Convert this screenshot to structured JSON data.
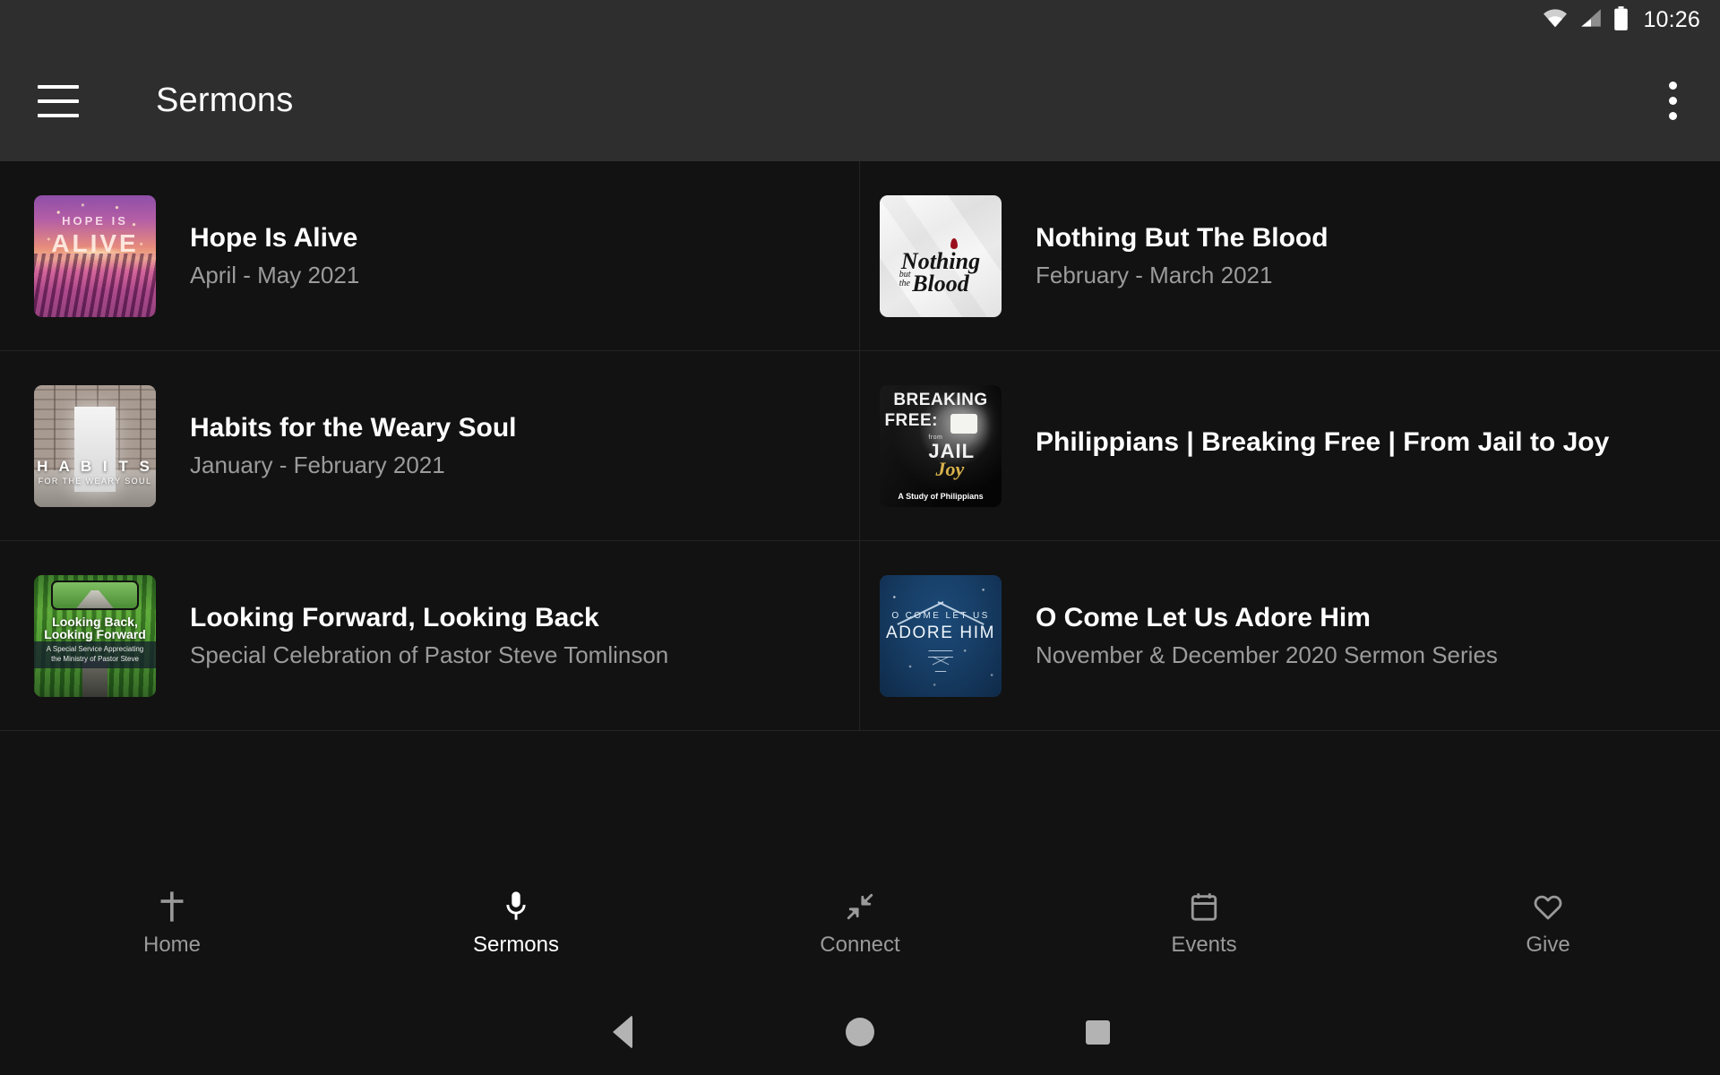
{
  "status_bar": {
    "time": "10:26",
    "icons": [
      "wifi-icon",
      "cellular-signal-icon",
      "battery-icon"
    ]
  },
  "app_bar": {
    "menu_icon": "hamburger-menu-icon",
    "title": "Sermons",
    "overflow_icon": "more-vertical-icon"
  },
  "sermons": [
    {
      "title": "Hope Is Alive",
      "subtitle": "April - May 2021",
      "thumb": {
        "style": "art-hope",
        "line1": "HOPE IS",
        "line2": "ALIVE"
      }
    },
    {
      "title": "Nothing But The Blood",
      "subtitle": "February - March 2021",
      "thumb": {
        "style": "art-blood",
        "word1": "Nothing",
        "word2": "Blood",
        "small1": "but",
        "small2": "the"
      }
    },
    {
      "title": "Habits for the Weary Soul",
      "subtitle": "January - February 2021",
      "thumb": {
        "style": "art-habits",
        "line1": "H A B I T S",
        "line2": "FOR THE WEARY SOUL"
      }
    },
    {
      "title": "Philippians | Breaking Free | From Jail to Joy",
      "subtitle": "",
      "thumb": {
        "style": "art-jail",
        "line1": "BREAKING",
        "line2": "FREE:",
        "line3": "JAIL",
        "line_from": "from",
        "line4": "Joy",
        "line5": "A Study of Philippians"
      }
    },
    {
      "title": "Looking Forward, Looking Back",
      "subtitle": "Special Celebration of Pastor Steve Tomlinson",
      "thumb": {
        "style": "art-look",
        "line1": "Looking Back,",
        "line2": "Looking Forward",
        "line3": "A Special Service Appreciating",
        "line4": "the Ministry of Pastor Steve"
      }
    },
    {
      "title": "O Come Let Us Adore Him",
      "subtitle": "November & December 2020 Sermon Series",
      "thumb": {
        "style": "art-adore",
        "line1": "O COME LET US",
        "line2": "ADORE HIM"
      }
    }
  ],
  "bottom_tabs": [
    {
      "label": "Home",
      "icon": "cross-icon",
      "active": false
    },
    {
      "label": "Sermons",
      "icon": "microphone-icon",
      "active": true
    },
    {
      "label": "Connect",
      "icon": "compress-arrows-icon",
      "active": false
    },
    {
      "label": "Events",
      "icon": "calendar-icon",
      "active": false
    },
    {
      "label": "Give",
      "icon": "heart-outline-icon",
      "active": false
    }
  ],
  "android_nav": {
    "back": "back-triangle-icon",
    "home": "home-circle-icon",
    "recents": "recents-square-icon"
  },
  "colors": {
    "app_bar_bg": "#2e2e2e",
    "page_bg": "#121212",
    "title_text": "#ffffff",
    "subtitle_text": "#9b9b9b",
    "divider": "#242424",
    "active_tab": "#ffffff",
    "inactive_tab": "#9a9a9a"
  }
}
